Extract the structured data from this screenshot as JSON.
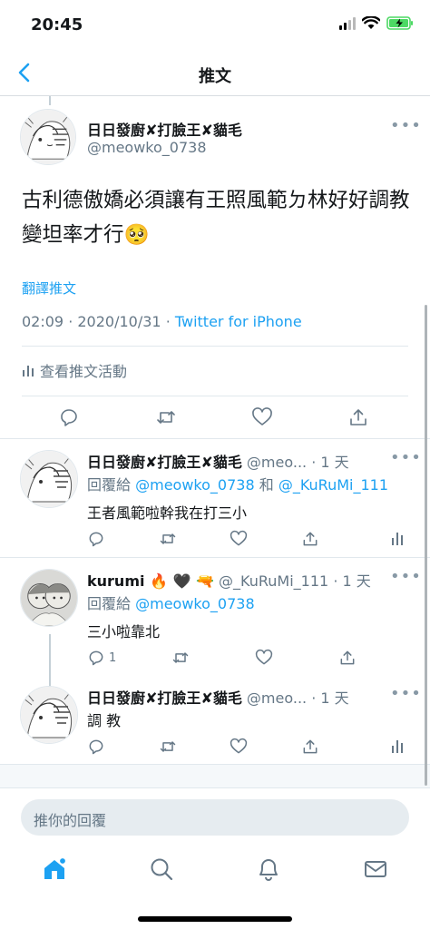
{
  "status": {
    "time": "20:45"
  },
  "nav": {
    "title": "推文"
  },
  "main_tweet": {
    "name": "日日發廚✘打臉王✘貓毛",
    "handle": "@meowko_0738",
    "text": "古利德傲嬌必須讓有王照風範ㄉ林好好調教變坦率才行🥺",
    "translate": "翻譯推文",
    "time": "02:09",
    "date": "2020/10/31",
    "source": "Twitter for iPhone",
    "activity": "查看推文活動"
  },
  "replies": [
    {
      "name": "日日發廚✘打臉王✘貓毛",
      "handle": "@meo...",
      "age": "· 1 天",
      "reply_prefix": "回覆給",
      "reply_to_1": "@meowko_0738",
      "reply_and": "和",
      "reply_to_2": "@_KuRuMi_111",
      "text": "王者風範啦幹我在打三小",
      "reply_count": ""
    },
    {
      "name": "kurumi 🔥 🖤 🔫",
      "handle": "@_KuRuMi_111",
      "age": "· 1 天",
      "reply_prefix": "回覆給",
      "reply_to_1": "@meowko_0738",
      "text": "三小啦靠北",
      "reply_count": "1"
    },
    {
      "name": "日日發廚✘打臉王✘貓毛",
      "handle": "@meo...",
      "age": "· 1 天",
      "text": "調 教",
      "reply_count": ""
    }
  ],
  "compose": {
    "placeholder": "推你的回覆"
  },
  "colors": {
    "accent": "#1da1f2",
    "muted": "#657786",
    "battery": "#4cd964"
  },
  "icons": [
    "back-icon",
    "reply-icon",
    "retweet-icon",
    "like-icon",
    "share-icon",
    "analytics-icon",
    "home-icon",
    "search-icon",
    "notifications-icon",
    "messages-icon"
  ]
}
